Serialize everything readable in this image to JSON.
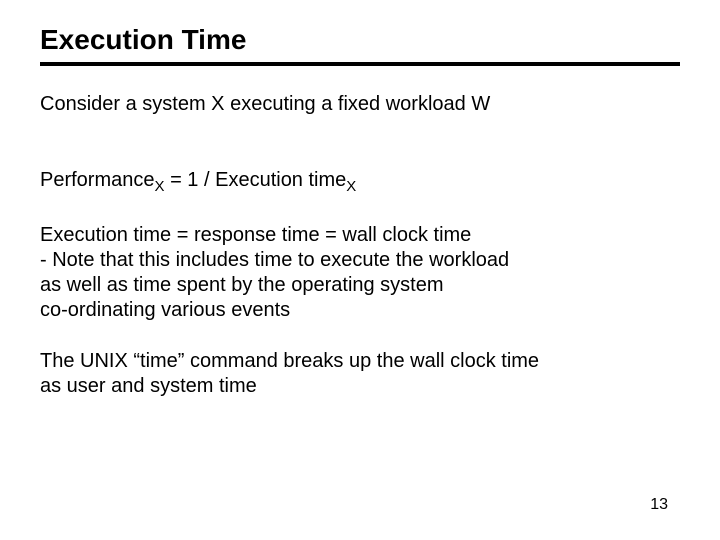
{
  "title": "Execution Time",
  "line1": "Consider a system X executing a fixed workload W",
  "perf_lhs": "Performance",
  "perf_sub": "X",
  "perf_mid": " = 1 / Execution time",
  "perf_sub2": "X",
  "definition_block": "Execution time = response time = wall clock time\n    - Note that this includes time to execute the workload\n      as well as time spent by the operating system\n      co-ordinating various events",
  "unix_block": "The UNIX “time” command breaks up the wall clock time\n as user and system time",
  "page_number": "13"
}
